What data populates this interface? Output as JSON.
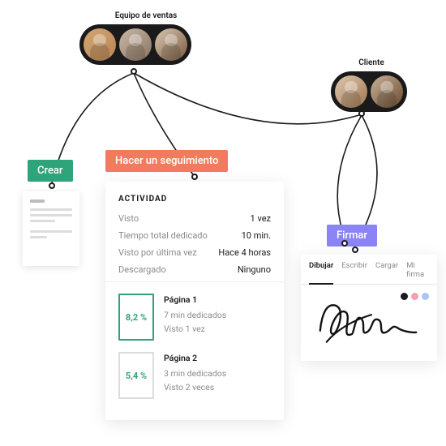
{
  "groups": {
    "sales": {
      "label": "Equipo de ventas"
    },
    "client": {
      "label": "Cliente"
    }
  },
  "tags": {
    "create": "Crear",
    "follow": "Hacer un seguimiento",
    "sign": "Firmar"
  },
  "activity": {
    "heading": "ACTIVIDAD",
    "rows": {
      "viewed": {
        "label": "Visto",
        "value": "1 vez"
      },
      "time": {
        "label": "Tiempo total dedicado",
        "value": "10 min."
      },
      "last": {
        "label": "Visto por última vez",
        "value": "Hace 4 horas"
      },
      "downloaded": {
        "label": "Descargado",
        "value": "Ninguno"
      }
    },
    "pages": {
      "p1": {
        "pct": "8,2 %",
        "title": "Página 1",
        "spent": "7 min dedicados",
        "views": "Visto 1 vez"
      },
      "p2": {
        "pct": "5,4 %",
        "title": "Página 2",
        "spent": "3 min dedicados",
        "views": "Visto 2 veces"
      }
    }
  },
  "signature": {
    "tabs": {
      "draw": "Dibujar",
      "type": "Escribir",
      "upload": "Cargar",
      "mine": "Mi firma"
    }
  }
}
